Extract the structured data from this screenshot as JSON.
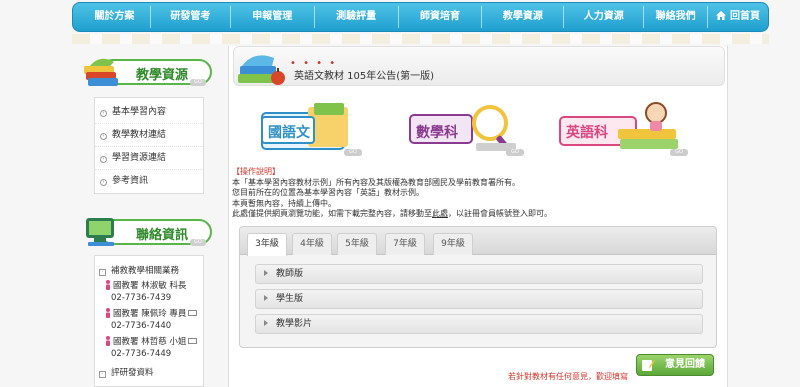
{
  "nav": {
    "items": [
      {
        "label": "關於方案"
      },
      {
        "label": "研發管考"
      },
      {
        "label": "申報管理"
      },
      {
        "label": "測驗評量"
      },
      {
        "label": "師資培育"
      },
      {
        "label": "教學資源"
      },
      {
        "label": "人力資源"
      },
      {
        "label": "聯絡我們"
      },
      {
        "label": "回首頁"
      }
    ]
  },
  "sidebar": {
    "resources_title": "教學資源",
    "go_label": "GO",
    "links": [
      "基本學習內容",
      "教學教材連結",
      "學習資源連結",
      "參考資訊"
    ],
    "contact_title": "聯絡資訊",
    "contact_section": "補救教學相關業務",
    "contacts": [
      {
        "name": "國教署 林淑敏 科長",
        "phone": "02-7736-7439"
      },
      {
        "name": "國教署 陳佩玲 專員",
        "phone": "02-7736-7440"
      },
      {
        "name": "國教署 林哲慈 小姐",
        "phone": "02-7736-7449"
      }
    ],
    "bottom_cut_text": "評研發資料"
  },
  "main": {
    "title": "英語文教材 105年公告(第一版)",
    "dots": "• • • •",
    "subjects": [
      {
        "label": "國語文",
        "color": "#2f8fc7"
      },
      {
        "label": "數學科",
        "color": "#8a3b8f"
      },
      {
        "label": "英語科",
        "color": "#d94680"
      }
    ],
    "instructions": {
      "heading": "【操作說明】",
      "line1": "本「基本學習內容教材示例」所有內容及其版權為教育部國民及學前教育署所有。",
      "line2": "您目前所在的位置為基本學習內容「英語」教材示例。",
      "line3": "本頁暫無內容，持續上傳中。",
      "line4_prefix": "此處僅提供網頁瀏覽功能，如需下載完整內容，請移動至",
      "line4_link": "此處",
      "line4_suffix": "，以註冊會員帳號登入即可。"
    },
    "tabs": [
      "3年級",
      "4年級",
      "5年級",
      "7年級",
      "9年級"
    ],
    "active_tab": 0,
    "accordion": [
      "教師版",
      "學生版",
      "教學影片"
    ]
  },
  "feedback": {
    "note": "若針對教材有任何意見，歡迎填寫",
    "button_label": "意見回饋"
  },
  "colors": {
    "nav_blue": "#1f9fcf",
    "green": "#58b548",
    "red": "#d2362b"
  }
}
